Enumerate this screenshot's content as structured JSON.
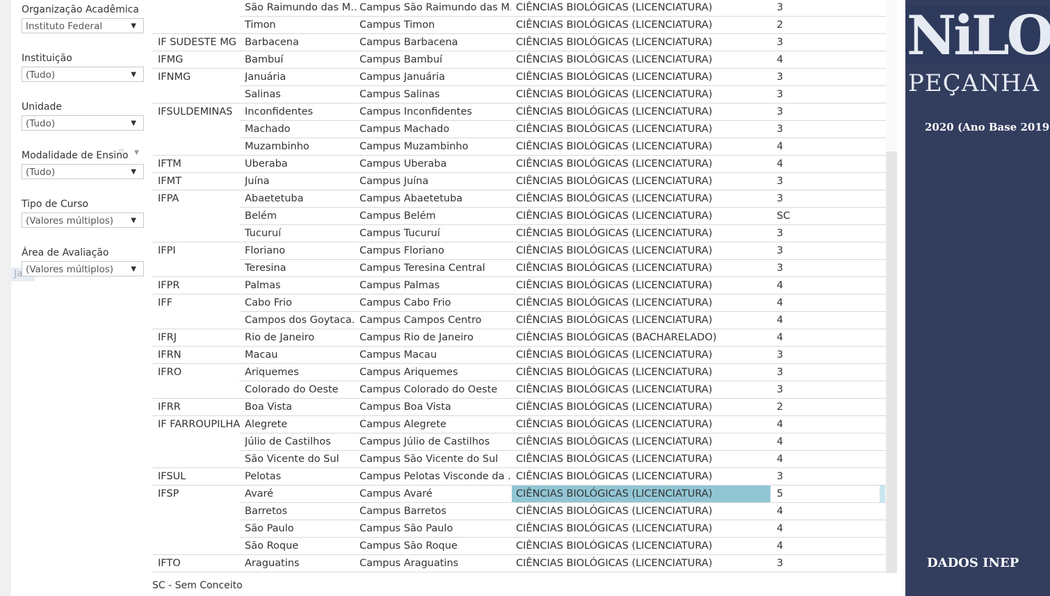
{
  "filters": [
    {
      "label": "Organização Acadêmica",
      "value": "Instituto Federal"
    },
    {
      "label": "Instituição",
      "value": "(Tudo)"
    },
    {
      "label": "Unidade",
      "value": "(Tudo)"
    },
    {
      "label": "Modalidade de Ensino",
      "value": "(Tudo)"
    },
    {
      "label": "Tipo de Curso",
      "value": "(Valores múltiplos)"
    },
    {
      "label": "Área de Avaliação",
      "value": "(Valores múltiplos)"
    }
  ],
  "ghost_text": "de Ja",
  "table": {
    "rows": [
      {
        "org": "",
        "mun": "São Raimundo das M..",
        "camp": "Campus São Raimundo das M..",
        "curso": "CIÊNCIAS BIOLÓGICAS (LICENCIATURA)",
        "nota": "3"
      },
      {
        "org": "",
        "mun": "Timon",
        "camp": "Campus Timon",
        "curso": "CIÊNCIAS BIOLÓGICAS (LICENCIATURA)",
        "nota": "2"
      },
      {
        "org": "IF SUDESTE MG",
        "mun": "Barbacena",
        "camp": "Campus Barbacena",
        "curso": "CIÊNCIAS BIOLÓGICAS (LICENCIATURA)",
        "nota": "3"
      },
      {
        "org": "IFMG",
        "mun": "Bambuí",
        "camp": "Campus Bambuí",
        "curso": "CIÊNCIAS BIOLÓGICAS (LICENCIATURA)",
        "nota": "4"
      },
      {
        "org": "IFNMG",
        "mun": "Januária",
        "camp": "Campus Januária",
        "curso": "CIÊNCIAS BIOLÓGICAS (LICENCIATURA)",
        "nota": "3"
      },
      {
        "org": "",
        "mun": "Salinas",
        "camp": "Campus Salinas",
        "curso": "CIÊNCIAS BIOLÓGICAS (LICENCIATURA)",
        "nota": "3"
      },
      {
        "org": "IFSULDEMINAS",
        "mun": "Inconfidentes",
        "camp": "Campus Inconfidentes",
        "curso": "CIÊNCIAS BIOLÓGICAS (LICENCIATURA)",
        "nota": "3"
      },
      {
        "org": "",
        "mun": "Machado",
        "camp": "Campus Machado",
        "curso": "CIÊNCIAS BIOLÓGICAS (LICENCIATURA)",
        "nota": "3"
      },
      {
        "org": "",
        "mun": "Muzambinho",
        "camp": "Campus Muzambinho",
        "curso": "CIÊNCIAS BIOLÓGICAS (LICENCIATURA)",
        "nota": "4"
      },
      {
        "org": "IFTM",
        "mun": "Uberaba",
        "camp": "Campus Uberaba",
        "curso": "CIÊNCIAS BIOLÓGICAS (LICENCIATURA)",
        "nota": "4"
      },
      {
        "org": "IFMT",
        "mun": "Juína",
        "camp": "Campus Juína",
        "curso": "CIÊNCIAS BIOLÓGICAS (LICENCIATURA)",
        "nota": "3"
      },
      {
        "org": "IFPA",
        "mun": "Abaetetuba",
        "camp": "Campus Abaetetuba",
        "curso": "CIÊNCIAS BIOLÓGICAS (LICENCIATURA)",
        "nota": "3"
      },
      {
        "org": "",
        "mun": "Belém",
        "camp": "Campus Belém",
        "curso": "CIÊNCIAS BIOLÓGICAS (LICENCIATURA)",
        "nota": "SC"
      },
      {
        "org": "",
        "mun": "Tucuruí",
        "camp": "Campus Tucuruí",
        "curso": "CIÊNCIAS BIOLÓGICAS (LICENCIATURA)",
        "nota": "3"
      },
      {
        "org": "IFPI",
        "mun": "Floriano",
        "camp": "Campus Floriano",
        "curso": "CIÊNCIAS BIOLÓGICAS (LICENCIATURA)",
        "nota": "3"
      },
      {
        "org": "",
        "mun": "Teresina",
        "camp": "Campus Teresina Central",
        "curso": "CIÊNCIAS BIOLÓGICAS (LICENCIATURA)",
        "nota": "3"
      },
      {
        "org": "IFPR",
        "mun": "Palmas",
        "camp": "Campus Palmas",
        "curso": "CIÊNCIAS BIOLÓGICAS (LICENCIATURA)",
        "nota": "4"
      },
      {
        "org": "IFF",
        "mun": "Cabo Frio",
        "camp": "Campus Cabo Frio",
        "curso": "CIÊNCIAS BIOLÓGICAS (LICENCIATURA)",
        "nota": "4"
      },
      {
        "org": "",
        "mun": "Campos dos Goytaca..",
        "camp": "Campus Campos Centro",
        "curso": "CIÊNCIAS BIOLÓGICAS (LICENCIATURA)",
        "nota": "4"
      },
      {
        "org": "IFRJ",
        "mun": "Rio de Janeiro",
        "camp": "Campus Rio de Janeiro",
        "curso": "CIÊNCIAS BIOLÓGICAS (BACHARELADO)",
        "nota": "4"
      },
      {
        "org": "IFRN",
        "mun": "Macau",
        "camp": "Campus Macau",
        "curso": "CIÊNCIAS BIOLÓGICAS (LICENCIATURA)",
        "nota": "3"
      },
      {
        "org": "IFRO",
        "mun": "Ariquemes",
        "camp": "Campus Ariquemes",
        "curso": "CIÊNCIAS BIOLÓGICAS (LICENCIATURA)",
        "nota": "3"
      },
      {
        "org": "",
        "mun": "Colorado do Oeste",
        "camp": "Campus Colorado do Oeste",
        "curso": "CIÊNCIAS BIOLÓGICAS (LICENCIATURA)",
        "nota": "3"
      },
      {
        "org": "IFRR",
        "mun": "Boa Vista",
        "camp": "Campus Boa Vista",
        "curso": "CIÊNCIAS BIOLÓGICAS (LICENCIATURA)",
        "nota": "2"
      },
      {
        "org": "IF FARROUPILHA",
        "mun": "Alegrete",
        "camp": "Campus Alegrete",
        "curso": "CIÊNCIAS BIOLÓGICAS (LICENCIATURA)",
        "nota": "4"
      },
      {
        "org": "",
        "mun": "Júlio de Castilhos",
        "camp": "Campus Júlio de Castilhos",
        "curso": "CIÊNCIAS BIOLÓGICAS (LICENCIATURA)",
        "nota": "4"
      },
      {
        "org": "",
        "mun": "São Vicente do Sul",
        "camp": "Campus São Vicente do Sul",
        "curso": "CIÊNCIAS BIOLÓGICAS (LICENCIATURA)",
        "nota": "4"
      },
      {
        "org": "IFSUL",
        "mun": "Pelotas",
        "camp": "Campus Pelotas Visconde da ..",
        "curso": "CIÊNCIAS BIOLÓGICAS (LICENCIATURA)",
        "nota": "3"
      },
      {
        "org": "IFSP",
        "mun": "Avaré",
        "camp": "Campus Avaré",
        "curso": "CIÊNCIAS BIOLÓGICAS (LICENCIATURA)",
        "nota": "5",
        "selected": true
      },
      {
        "org": "",
        "mun": "Barretos",
        "camp": "Campus Barretos",
        "curso": "CIÊNCIAS BIOLÓGICAS (LICENCIATURA)",
        "nota": "4"
      },
      {
        "org": "",
        "mun": "São Paulo",
        "camp": "Campus São Paulo",
        "curso": "CIÊNCIAS BIOLÓGICAS (LICENCIATURA)",
        "nota": "4"
      },
      {
        "org": "",
        "mun": "São Roque",
        "camp": "Campus São Roque",
        "curso": "CIÊNCIAS BIOLÓGICAS (LICENCIATURA)",
        "nota": "4"
      },
      {
        "org": "IFTO",
        "mun": "Araguatins",
        "camp": "Campus Araguatins",
        "curso": "CIÊNCIAS BIOLÓGICAS (LICENCIATURA)",
        "nota": "3"
      }
    ]
  },
  "footnote": "SC - Sem Conceito",
  "side_panel": {
    "logo_line1": "NiLO",
    "logo_line2": "PEÇANHA",
    "year": "2020 (Ano Base 2019)",
    "source": "DADOS INEP",
    "bg_color": "#333e5f"
  },
  "colors": {
    "highlight": "#92c6d5"
  }
}
